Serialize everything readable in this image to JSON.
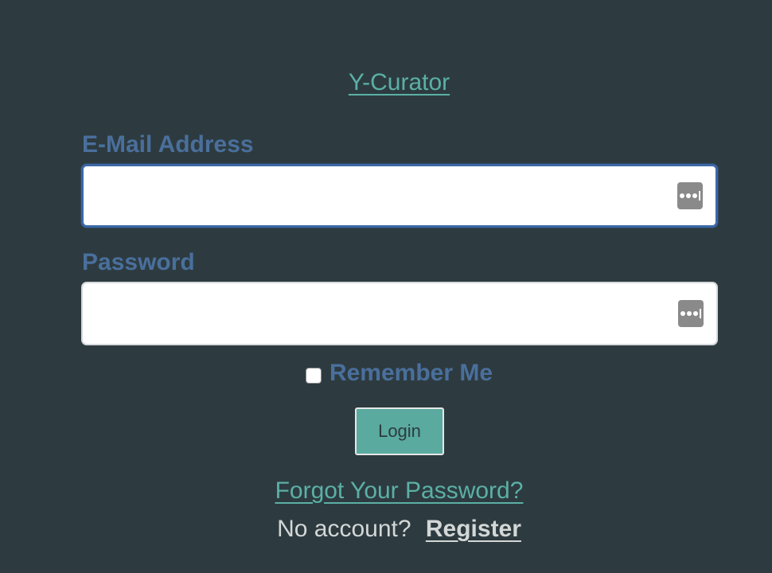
{
  "header": {
    "brand": "Y-Curator"
  },
  "form": {
    "email": {
      "label": "E-Mail Address",
      "value": "",
      "placeholder": ""
    },
    "password": {
      "label": "Password",
      "value": "",
      "placeholder": ""
    },
    "remember": {
      "label": "Remember Me",
      "checked": false
    },
    "submit_label": "Login"
  },
  "links": {
    "forgot": "Forgot Your Password?",
    "no_account": "No account?",
    "register": "Register"
  },
  "icons": {
    "password_manager": "password-manager-icon"
  },
  "colors": {
    "background": "#2d3b40",
    "accent_teal": "#5bb0a6",
    "label_blue": "#4a6f9c",
    "focus_border": "#3c68a8",
    "button_bg": "#5aaa9f",
    "muted_text": "#d3d7d7"
  }
}
